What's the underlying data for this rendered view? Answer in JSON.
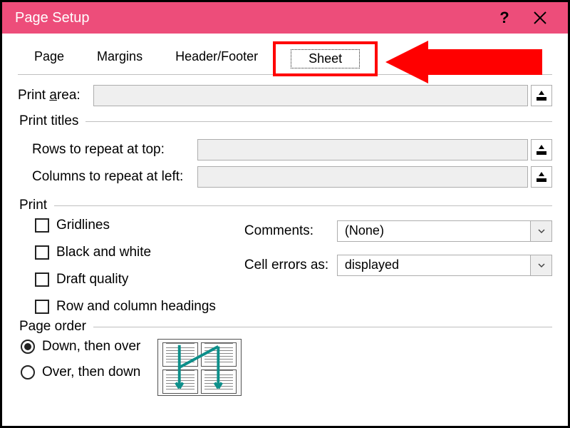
{
  "title": "Page Setup",
  "help": "?",
  "tabs": {
    "page": "Page",
    "margins": "Margins",
    "headerfooter": "Header/Footer",
    "sheet": "Sheet"
  },
  "printArea": {
    "label": "Print area:",
    "value": ""
  },
  "printTitles": {
    "legend": "Print titles",
    "rows": {
      "label": "Rows to repeat at top:",
      "value": ""
    },
    "cols": {
      "label": "Columns to repeat at left:",
      "value": ""
    }
  },
  "print": {
    "legend": "Print",
    "gridlines": "Gridlines",
    "bw": "Black and white",
    "draft": "Draft quality",
    "headings": "Row and column headings",
    "comments": {
      "label": "Comments:",
      "value": "(None)"
    },
    "errors": {
      "label": "Cell errors as:",
      "value": "displayed"
    }
  },
  "order": {
    "legend": "Page order",
    "down": "Down, then over",
    "over": "Over, then down"
  }
}
